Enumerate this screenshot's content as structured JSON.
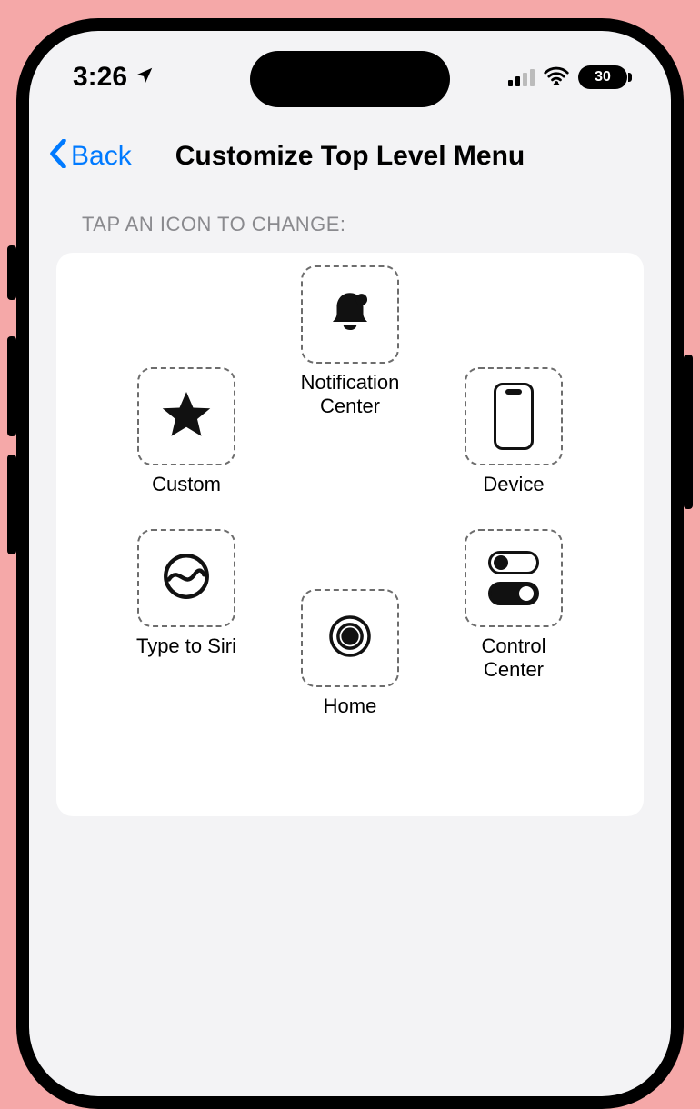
{
  "status": {
    "time": "3:26",
    "battery": "30"
  },
  "nav": {
    "back": "Back",
    "title": "Customize Top Level Menu"
  },
  "section_header": "TAP AN ICON TO CHANGE:",
  "slots": {
    "top": {
      "label": "Notification Center",
      "icon": "notification-bell-icon"
    },
    "left1": {
      "label": "Custom",
      "icon": "star-icon"
    },
    "right1": {
      "label": "Device",
      "icon": "phone-device-icon"
    },
    "left2": {
      "label": "Type to Siri",
      "icon": "siri-icon"
    },
    "right2": {
      "label": "Control Center",
      "icon": "toggles-icon"
    },
    "bottom": {
      "label": "Home",
      "icon": "home-button-icon"
    }
  }
}
